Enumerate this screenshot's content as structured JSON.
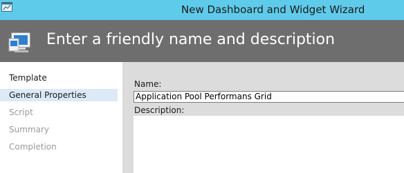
{
  "window": {
    "title": "New Dashboard and Widget Wizard"
  },
  "header": {
    "title": "Enter a friendly name and description"
  },
  "sidebar": {
    "items": [
      {
        "label": "Template",
        "state": "normal"
      },
      {
        "label": "General Properties",
        "state": "active"
      },
      {
        "label": "Script",
        "state": "disabled"
      },
      {
        "label": "Summary",
        "state": "disabled"
      },
      {
        "label": "Completion",
        "state": "disabled"
      }
    ]
  },
  "form": {
    "name_label": "Name:",
    "name_value": "Application Pool Performans Grid",
    "description_label": "Description:",
    "description_value": ""
  },
  "colors": {
    "titlebar": "#5fcbea",
    "header": "#6e6e6e",
    "content": "#dcdcdc",
    "active_item": "#dceaf7"
  },
  "icons": {
    "app": "window-icon",
    "header": "monitor-icon"
  }
}
